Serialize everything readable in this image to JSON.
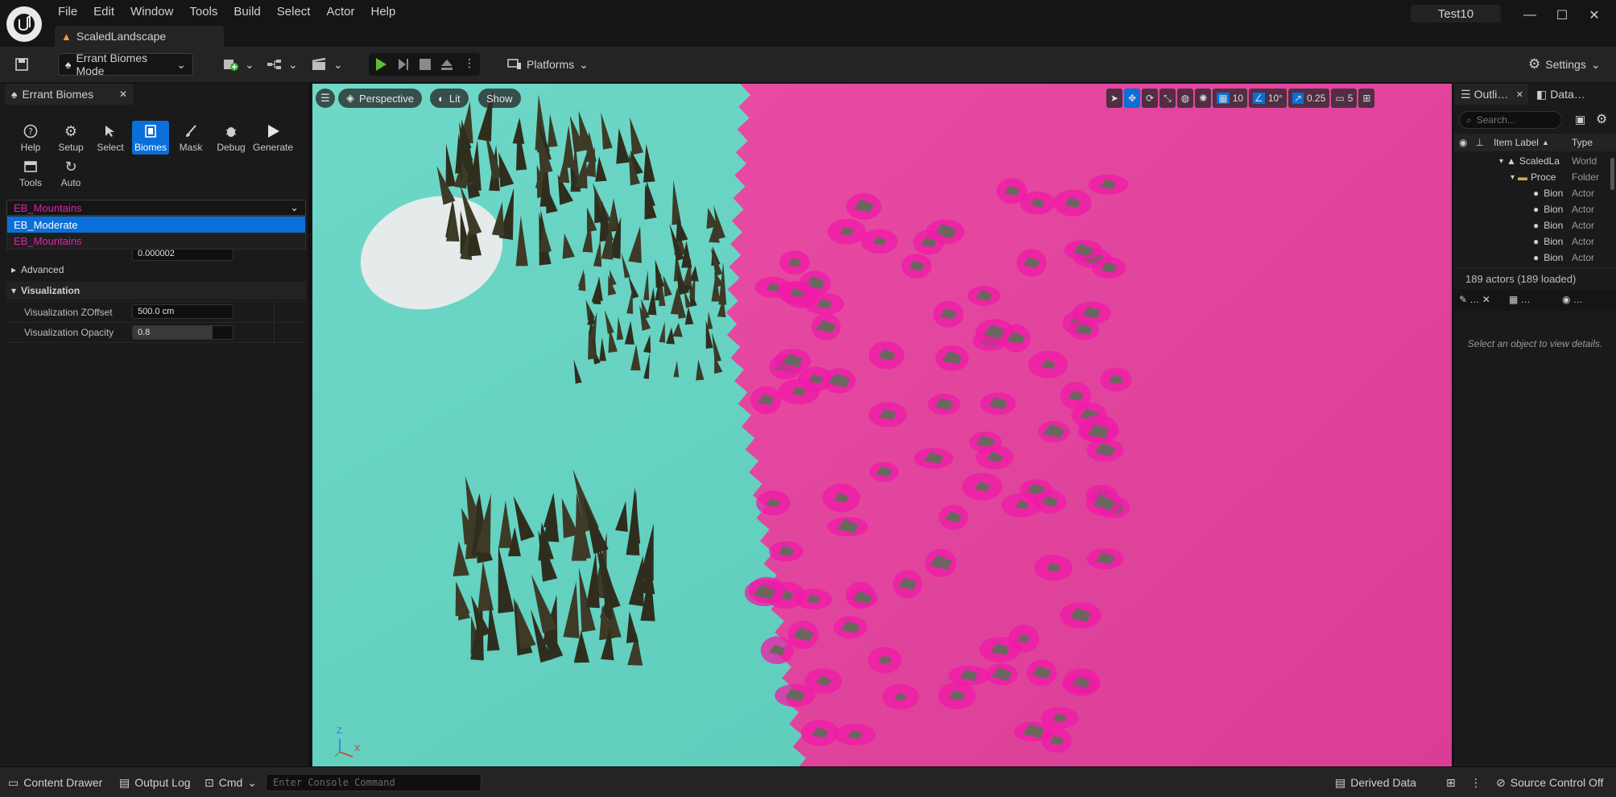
{
  "menu": [
    "File",
    "Edit",
    "Window",
    "Tools",
    "Build",
    "Select",
    "Actor",
    "Help"
  ],
  "document_tab": "ScaledLandscape",
  "project_name": "Test10",
  "toolbar": {
    "mode_label": "Errant Biomes Mode",
    "platforms_label": "Platforms",
    "settings_label": "Settings"
  },
  "left_panel": {
    "tab_title": "Errant Biomes",
    "tools": [
      {
        "label": "Help",
        "icon": "help-icon"
      },
      {
        "label": "Setup",
        "icon": "gear-icon"
      },
      {
        "label": "Select",
        "icon": "select-icon"
      },
      {
        "label": "Biomes",
        "icon": "biomes-icon",
        "active": true
      },
      {
        "label": "Mask",
        "icon": "brush-icon"
      },
      {
        "label": "Debug",
        "icon": "bug-icon"
      },
      {
        "label": "Generate",
        "icon": "play-icon"
      },
      {
        "label": "Tools",
        "icon": "tools-icon"
      },
      {
        "label": "Auto",
        "icon": "refresh-icon"
      }
    ],
    "biome_selected": "EB_Mountains",
    "biome_options": [
      {
        "label": "EB_Moderate",
        "highlighted": true
      },
      {
        "label": "EB_Mountains",
        "highlighted": false
      }
    ],
    "radius_value": "0.000002",
    "advanced_label": "Advanced",
    "visualization_label": "Visualization",
    "viz_zoffset_label": "Visualization ZOffset",
    "viz_zoffset_value": "500.0 cm",
    "viz_opacity_label": "Visualization Opacity",
    "viz_opacity_value": "0.8",
    "viz_opacity_fraction": 0.8
  },
  "viewport": {
    "perspective_label": "Perspective",
    "lit_label": "Lit",
    "show_label": "Show",
    "grid_snap": "10",
    "rotation_snap": "10°",
    "scale_snap": "0.25",
    "camera_speed": "5",
    "colors": {
      "moderate": "#5ed0c0",
      "mountains": "#e0409c"
    },
    "axis_labels": {
      "z": "Z",
      "x": "X"
    }
  },
  "outliner": {
    "tab_label": "Outli…",
    "data_tab_label": "Data…",
    "search_placeholder": "Search...",
    "col_label": "Item Label",
    "col_type": "Type",
    "rows": [
      {
        "label": "ScaledLa",
        "type": "World",
        "indent": 1,
        "icon": "level-icon"
      },
      {
        "label": "Proce",
        "type": "Folder",
        "indent": 2,
        "icon": "folder-icon"
      },
      {
        "label": "Bion",
        "type": "Actor",
        "indent": 3,
        "icon": "actor-icon"
      },
      {
        "label": "Bion",
        "type": "Actor",
        "indent": 3,
        "icon": "actor-icon"
      },
      {
        "label": "Bion",
        "type": "Actor",
        "indent": 3,
        "icon": "actor-icon"
      },
      {
        "label": "Bion",
        "type": "Actor",
        "indent": 3,
        "icon": "actor-icon"
      },
      {
        "label": "Bion",
        "type": "Actor",
        "indent": 3,
        "icon": "actor-icon"
      }
    ],
    "actor_count": "189 actors (189 loaded)",
    "details_empty": "Select an object to view details."
  },
  "statusbar": {
    "content_drawer": "Content Drawer",
    "output_log": "Output Log",
    "cmd_label": "Cmd",
    "console_placeholder": "Enter Console Command",
    "derived_data": "Derived Data",
    "source_control": "Source Control Off"
  }
}
